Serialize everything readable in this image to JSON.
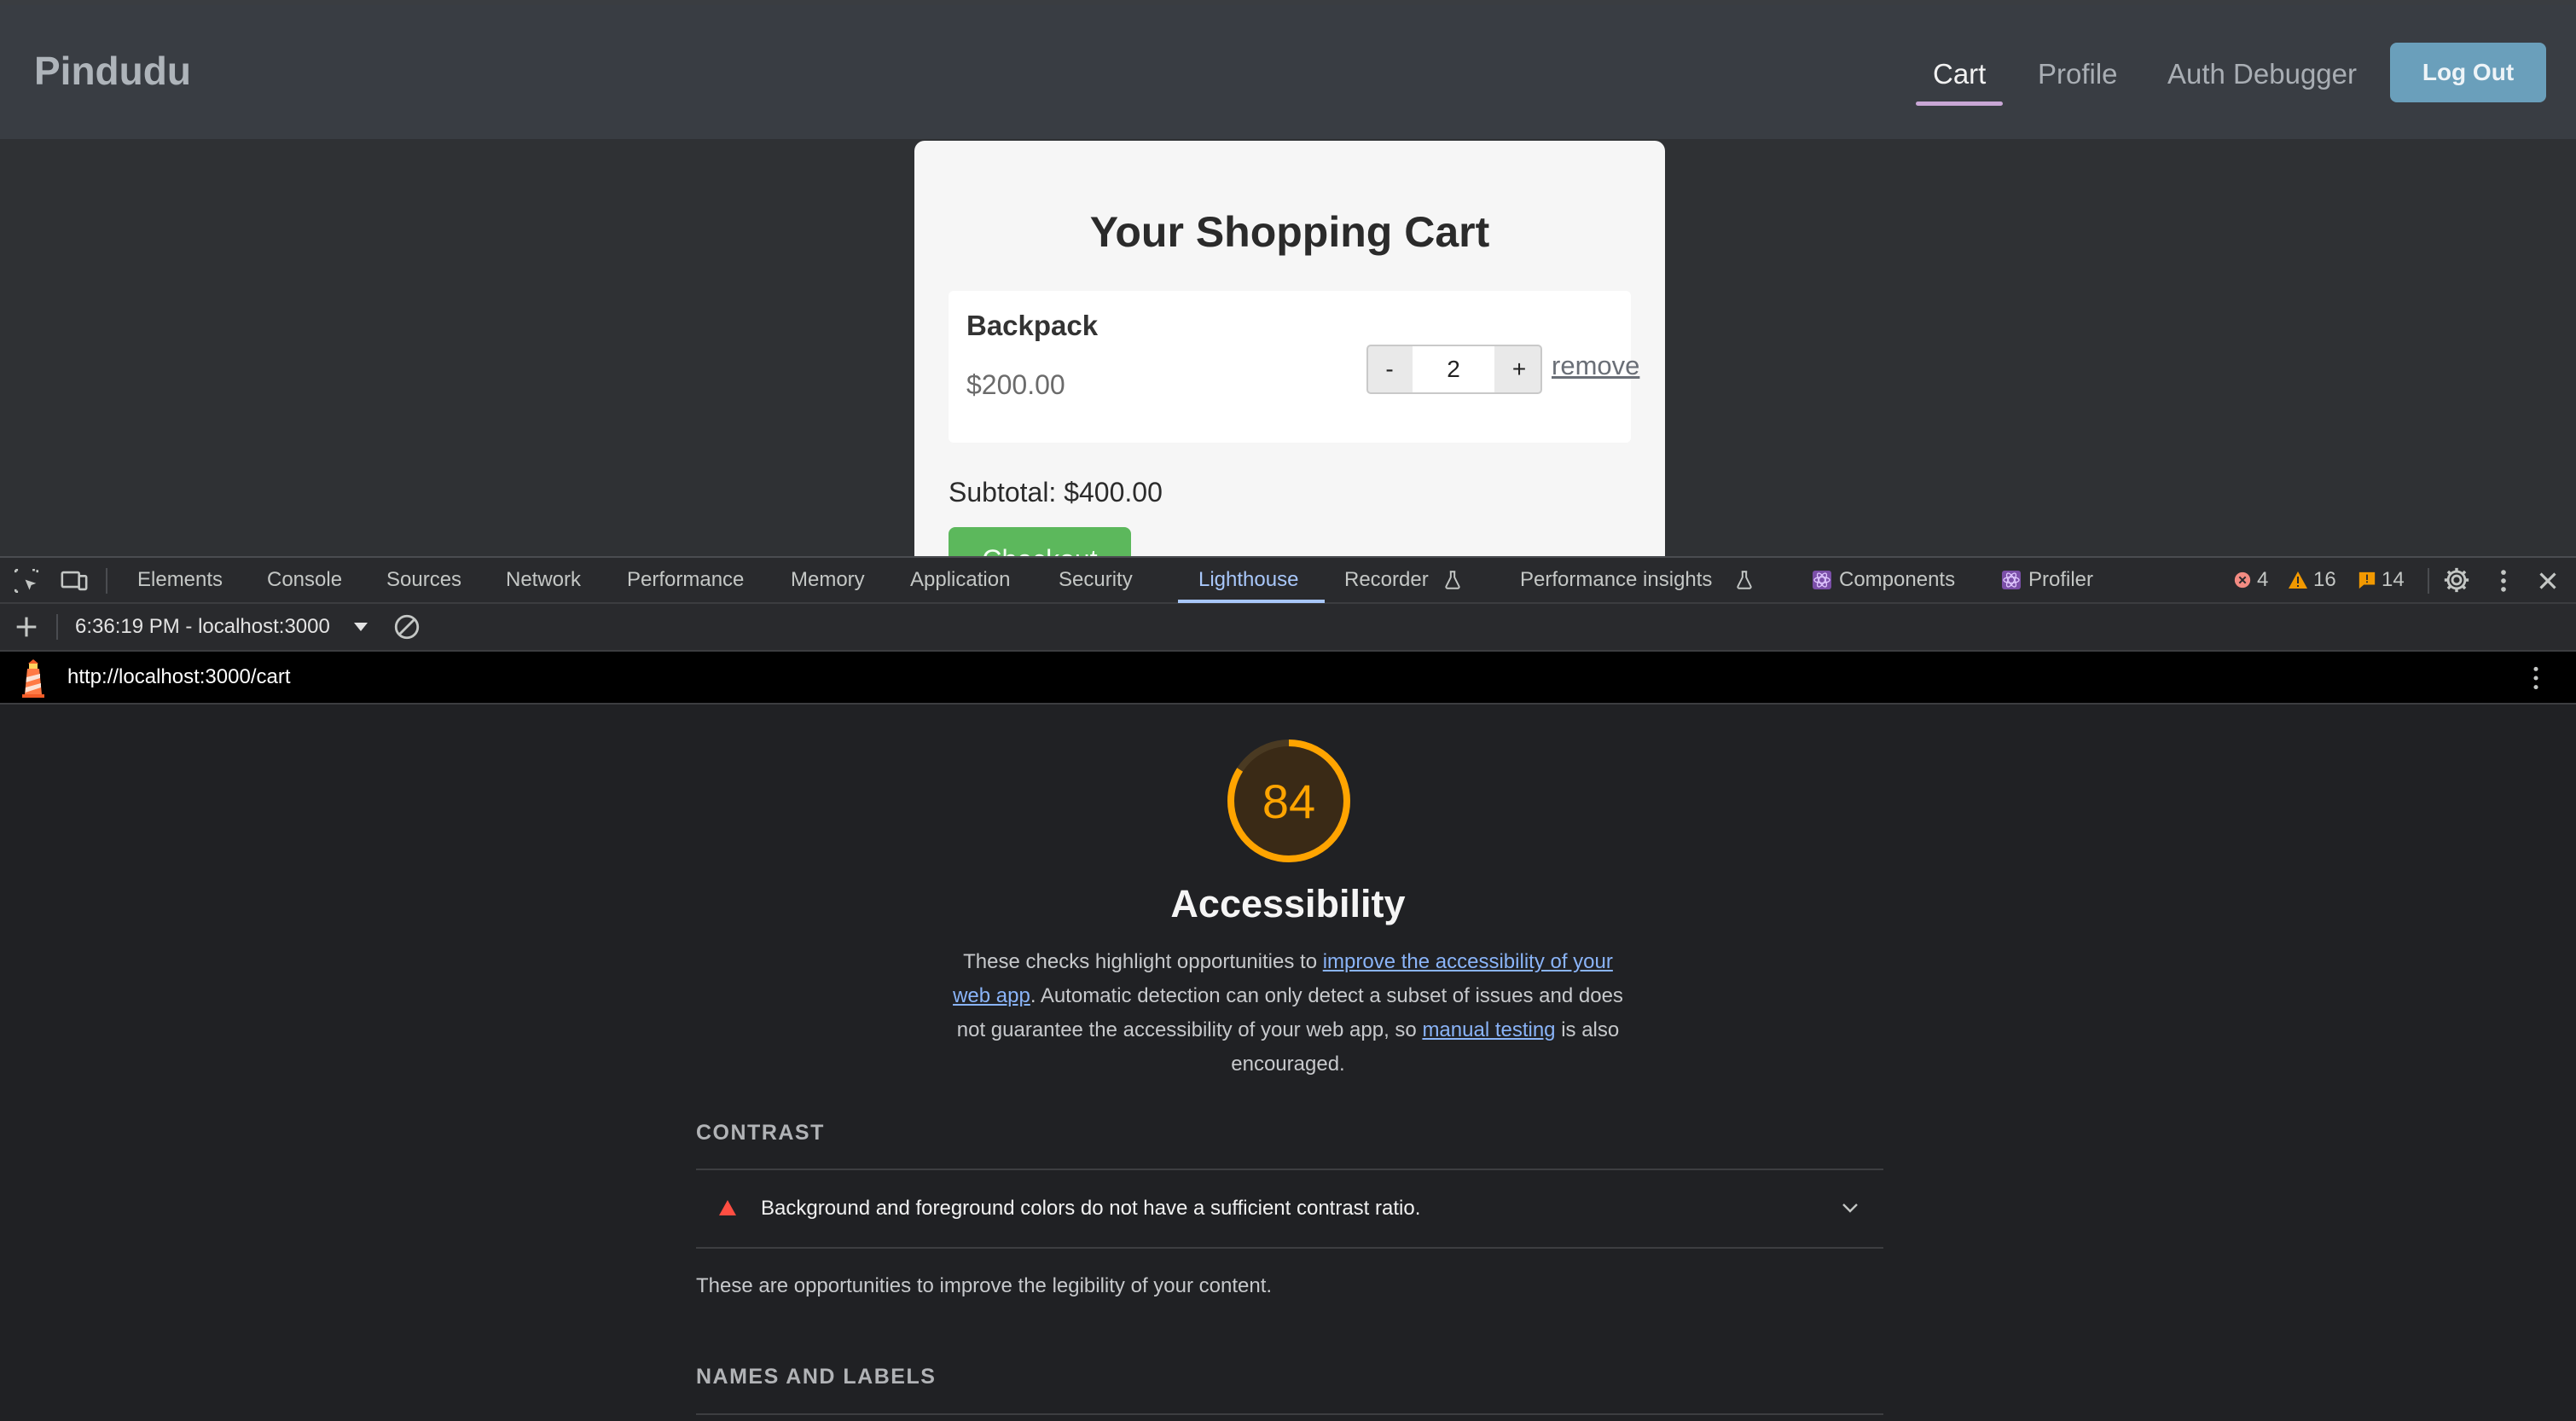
{
  "app": {
    "brand": "Pindudu",
    "nav": {
      "cart": "Cart",
      "profile": "Profile",
      "auth_debugger": "Auth Debugger",
      "logout": "Log Out"
    },
    "cart": {
      "title": "Your Shopping Cart",
      "item": {
        "name": "Backpack",
        "price": "$200.00",
        "qty_minus": "-",
        "quantity": "2",
        "qty_plus": "+",
        "remove": "remove"
      },
      "subtotal": "Subtotal: $400.00",
      "checkout": "Checkout"
    }
  },
  "devtools": {
    "tabs": [
      "Elements",
      "Console",
      "Sources",
      "Network",
      "Performance",
      "Memory",
      "Application",
      "Security",
      "Lighthouse",
      "Recorder",
      "Performance insights",
      "Components",
      "Profiler"
    ],
    "active_tab": "Lighthouse",
    "counts": {
      "errors": "4",
      "warnings": "16",
      "issues": "14"
    },
    "toolbar": {
      "report": "6:36:19 PM - localhost:3000"
    },
    "colors": {
      "accent": "#a8c7fa",
      "error": "#f28b82",
      "warning": "#fdd663",
      "issue": "#f29900"
    }
  },
  "lighthouse": {
    "url": "http://localhost:3000/cart",
    "score": "84",
    "score_value": 84,
    "score_color": "#ffa400",
    "category_title": "Accessibility",
    "description": {
      "part1": "These checks highlight opportunities to ",
      "link1": "improve the accessibility of your web app",
      "part2": ". Automatic detection can only detect a subset of issues and does not guarantee the accessibility of your web app, so ",
      "link2": "manual testing",
      "part3": " is also encouraged."
    },
    "groups": {
      "contrast": {
        "title": "CONTRAST",
        "audit": "Background and foreground colors do not have a sufficient contrast ratio.",
        "description": "These are opportunities to improve the legibility of your content."
      },
      "names_labels": {
        "title": "NAMES AND LABELS"
      }
    }
  }
}
